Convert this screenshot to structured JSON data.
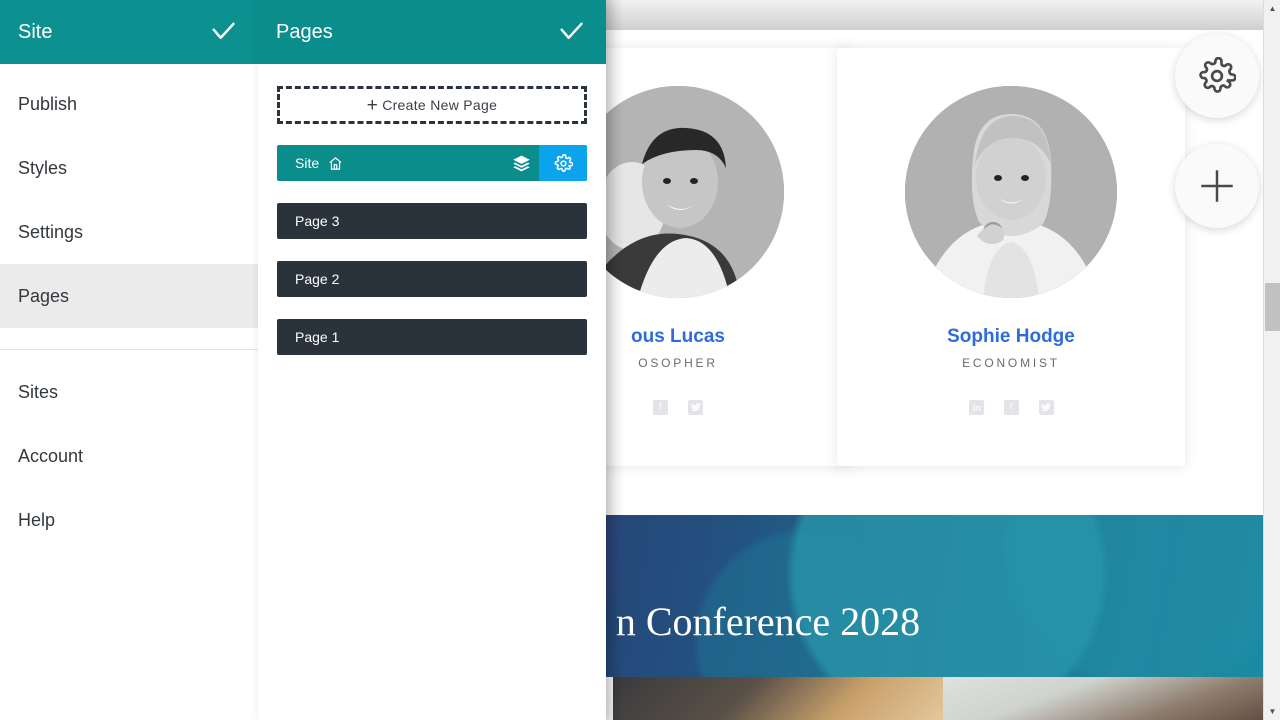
{
  "site_panel": {
    "title": "Site",
    "confirm_icon": "check-icon",
    "items": [
      {
        "label": "Publish",
        "active": false
      },
      {
        "label": "Styles",
        "active": false
      },
      {
        "label": "Settings",
        "active": false
      },
      {
        "label": "Pages",
        "active": true
      }
    ],
    "items_secondary": [
      {
        "label": "Sites",
        "active": false
      },
      {
        "label": "Account",
        "active": false
      },
      {
        "label": "Help",
        "active": false
      }
    ]
  },
  "pages_panel": {
    "title": "Pages",
    "confirm_icon": "check-icon",
    "create_button": {
      "label": "Create New Page",
      "plus": "+"
    },
    "rows": [
      {
        "label": "Site",
        "type": "site",
        "home_icon": "home-icon",
        "layers_icon": "layers-icon",
        "gear_icon": "gear-icon"
      },
      {
        "label": "Page 3",
        "type": "page"
      },
      {
        "label": "Page 2",
        "type": "page"
      },
      {
        "label": "Page 1",
        "type": "page"
      }
    ]
  },
  "canvas": {
    "team": [
      {
        "name": "ous Lucas",
        "role": "OSOPHER",
        "socials": [
          "facebook-icon",
          "twitter-icon"
        ]
      },
      {
        "name": "Sophie Hodge",
        "role": "ECONOMIST",
        "socials": [
          "linkedin-icon",
          "facebook-icon",
          "twitter-icon"
        ]
      }
    ],
    "banner_title": "n Conference 2028",
    "fab_gear": "gear-icon",
    "fab_plus": "plus-icon",
    "scrollbar": {
      "up": "▲",
      "down": "▼"
    }
  },
  "colors": {
    "teal": "#0d9190",
    "teal_dark": "#0b8d8c",
    "row_dark": "#2a323c",
    "blue_accent": "#0aa3ec",
    "name_blue": "#2f6bdd",
    "active_menu": "#ebebeb"
  }
}
